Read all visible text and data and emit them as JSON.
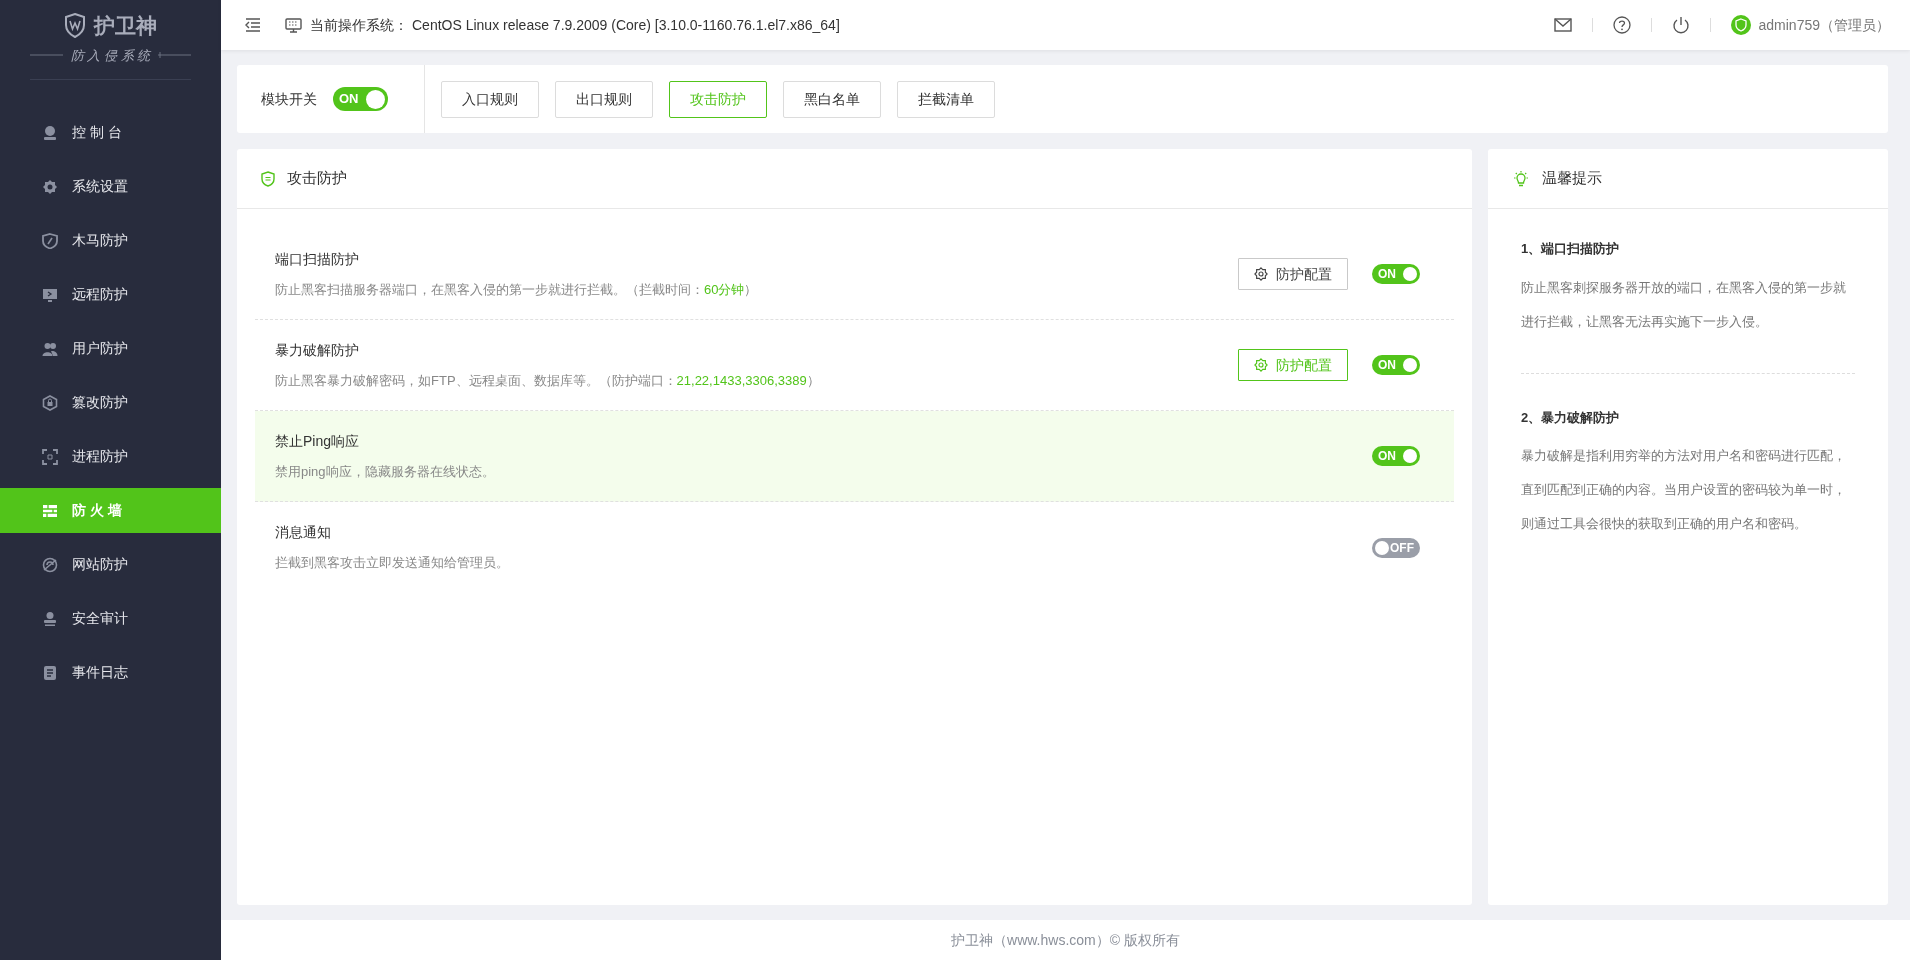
{
  "sidebar": {
    "brand": "护卫神",
    "subtitle": "防 入 侵 系 统",
    "items": [
      {
        "label": "控 制 台",
        "selected": false
      },
      {
        "label": "系统设置",
        "selected": false
      },
      {
        "label": "木马防护",
        "selected": false
      },
      {
        "label": "远程防护",
        "selected": false
      },
      {
        "label": "用户防护",
        "selected": false
      },
      {
        "label": "篡改防护",
        "selected": false
      },
      {
        "label": "进程防护",
        "selected": false
      },
      {
        "label": "防 火 墙",
        "selected": true
      },
      {
        "label": "网站防护",
        "selected": false
      },
      {
        "label": "安全审计",
        "selected": false
      },
      {
        "label": "事件日志",
        "selected": false
      }
    ]
  },
  "topbar": {
    "os_label": "当前操作系统：",
    "os_value": "CentOS Linux release 7.9.2009 (Core) [3.10.0-1160.76.1.el7.x86_64]",
    "user": "admin759（管理员）"
  },
  "module_switch": {
    "label": "模块开关",
    "on": true,
    "toggle_text": "ON"
  },
  "tabs": [
    {
      "label": "入口规则",
      "selected": false
    },
    {
      "label": "出口规则",
      "selected": false
    },
    {
      "label": "攻击防护",
      "selected": true
    },
    {
      "label": "黑白名单",
      "selected": false
    },
    {
      "label": "拦截清单",
      "selected": false
    }
  ],
  "panel": {
    "title": "攻击防护",
    "rows": [
      {
        "title": "端口扫描防护",
        "description": "防止黑客扫描服务器端口，在黑客入侵的第一步就进行拦截。（拦截时间：",
        "value": "60分钟",
        "suffix": "）",
        "config": {
          "label": "防护配置",
          "hover": false
        },
        "highlighted": false,
        "on": true,
        "toggle_text": "ON"
      },
      {
        "title": "暴力破解防护",
        "description": "防止黑客暴力破解密码，如FTP、远程桌面、数据库等。（防护端口：",
        "value": "21,22,1433,3306,3389",
        "suffix": "）",
        "config": {
          "label": "防护配置",
          "hover": true
        },
        "highlighted": false,
        "on": true,
        "toggle_text": "ON"
      },
      {
        "title": "禁止Ping响应",
        "description": "禁用ping响应，隐藏服务器在线状态。",
        "highlighted": true,
        "on": true,
        "toggle_text": "ON"
      },
      {
        "title": "消息通知",
        "description": "拦截到黑客攻击立即发送通知给管理员。",
        "highlighted": false,
        "on": false,
        "toggle_text": "OFF"
      }
    ]
  },
  "tips": {
    "title": "温馨提示",
    "items": [
      {
        "heading": "1、端口扫描防护",
        "text": "防止黑客刺探服务器开放的端口，在黑客入侵的第一步就进行拦截，让黑客无法再实施下一步入侵。"
      },
      {
        "heading": "2、暴力破解防护",
        "text": "暴力破解是指利用穷举的方法对用户名和密码进行匹配，直到匹配到正确的内容。当用户设置的密码较为单一时，则通过工具会很快的获取到正确的用户名和密码。"
      }
    ]
  },
  "footer": "护卫神（www.hws.com）© 版权所有"
}
